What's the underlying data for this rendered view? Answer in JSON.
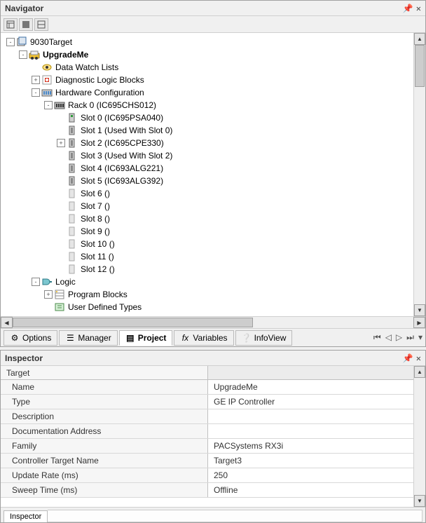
{
  "navigator": {
    "title": "Navigator",
    "tabs": [
      {
        "label": "Options"
      },
      {
        "label": "Manager"
      },
      {
        "label": "Project"
      },
      {
        "label": "Variables"
      },
      {
        "label": "InfoView"
      }
    ],
    "tree": [
      {
        "level": 0,
        "toggle": "-",
        "icon": "project",
        "label": "9030Target"
      },
      {
        "level": 1,
        "toggle": "-",
        "icon": "target",
        "label": "UpgradeMe",
        "bold": true
      },
      {
        "level": 2,
        "toggle": "",
        "icon": "watch",
        "label": "Data Watch Lists"
      },
      {
        "level": 2,
        "toggle": "+",
        "icon": "diag",
        "label": "Diagnostic Logic Blocks"
      },
      {
        "level": 2,
        "toggle": "-",
        "icon": "hw",
        "label": "Hardware Configuration"
      },
      {
        "level": 3,
        "toggle": "-",
        "icon": "rack",
        "label": "Rack 0 (IC695CHS012)"
      },
      {
        "level": 4,
        "toggle": "",
        "icon": "slot-p",
        "label": "Slot 0 (IC695PSA040)"
      },
      {
        "level": 4,
        "toggle": "",
        "icon": "slot",
        "label": "Slot 1 (Used With Slot 0)"
      },
      {
        "level": 4,
        "toggle": "+",
        "icon": "slot",
        "label": "Slot 2 (IC695CPE330)"
      },
      {
        "level": 4,
        "toggle": "",
        "icon": "slot",
        "label": "Slot 3 (Used With Slot 2)"
      },
      {
        "level": 4,
        "toggle": "",
        "icon": "slot",
        "label": "Slot 4 (IC693ALG221)"
      },
      {
        "level": 4,
        "toggle": "",
        "icon": "slot",
        "label": "Slot 5 (IC693ALG392)"
      },
      {
        "level": 4,
        "toggle": "",
        "icon": "slot-e",
        "label": "Slot 6 ()"
      },
      {
        "level": 4,
        "toggle": "",
        "icon": "slot-e",
        "label": "Slot 7 ()"
      },
      {
        "level": 4,
        "toggle": "",
        "icon": "slot-e",
        "label": "Slot 8 ()"
      },
      {
        "level": 4,
        "toggle": "",
        "icon": "slot-e",
        "label": "Slot 9 ()"
      },
      {
        "level": 4,
        "toggle": "",
        "icon": "slot-e",
        "label": "Slot 10 ()"
      },
      {
        "level": 4,
        "toggle": "",
        "icon": "slot-e",
        "label": "Slot 11 ()"
      },
      {
        "level": 4,
        "toggle": "",
        "icon": "slot-e",
        "label": "Slot 12 ()"
      },
      {
        "level": 2,
        "toggle": "-",
        "icon": "logic",
        "label": "Logic"
      },
      {
        "level": 3,
        "toggle": "+",
        "icon": "blocks",
        "label": "Program Blocks"
      },
      {
        "level": 3,
        "toggle": "",
        "icon": "udt",
        "label": "User Defined Types"
      }
    ]
  },
  "inspector": {
    "title": "Inspector",
    "headerLabel": "Target",
    "tabLabel": "Inspector",
    "rows": [
      {
        "k": "Name",
        "v": "UpgradeMe"
      },
      {
        "k": "Type",
        "v": "GE IP Controller"
      },
      {
        "k": "Description",
        "v": ""
      },
      {
        "k": "Documentation Address",
        "v": ""
      },
      {
        "k": "Family",
        "v": "PACSystems RX3i"
      },
      {
        "k": "Controller Target Name",
        "v": "Target3"
      },
      {
        "k": "Update Rate (ms)",
        "v": "250"
      },
      {
        "k": "Sweep Time (ms)",
        "v": "Offline"
      }
    ]
  }
}
